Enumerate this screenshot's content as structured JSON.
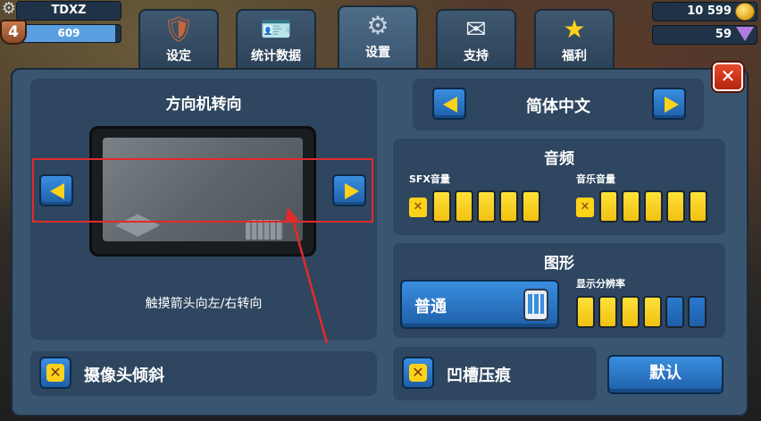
{
  "player": {
    "name": "TDXZ",
    "level": "4",
    "xp": "609",
    "xp_fill_fraction": 0.95
  },
  "currency": {
    "gold": "10 599",
    "gems": "59"
  },
  "tabs": [
    {
      "label": "设定",
      "icon": "shield-icon"
    },
    {
      "label": "统计数据",
      "icon": "id-card-icon"
    },
    {
      "label": "设置",
      "icon": "gear-icon"
    },
    {
      "label": "支持",
      "icon": "envelope-icon"
    },
    {
      "label": "福利",
      "icon": "star-icon"
    }
  ],
  "active_tab": "设置",
  "steering": {
    "title": "方向机转向",
    "hint": "触摸箭头向左/右转向"
  },
  "camera_tilt": {
    "label": "摄像头倾斜",
    "checked": false
  },
  "language": {
    "value": "简体中文"
  },
  "audio": {
    "title": "音频",
    "sfx_label": "SFX音量",
    "music_label": "音乐音量",
    "sfx_level": 5,
    "music_level": 5,
    "max_level": 5
  },
  "graphics": {
    "title": "图形",
    "quality": "普通",
    "resolution_label": "显示分辨率",
    "resolution_level": 4,
    "resolution_max": 6
  },
  "dent": {
    "label": "凹槽压痕",
    "checked": false
  },
  "default_button": "默认",
  "colors": {
    "accent_blue": "#2a7ad0",
    "accent_yellow": "#ffd21a",
    "highlight_red": "#e22a2a",
    "close_red": "#d0361c"
  }
}
